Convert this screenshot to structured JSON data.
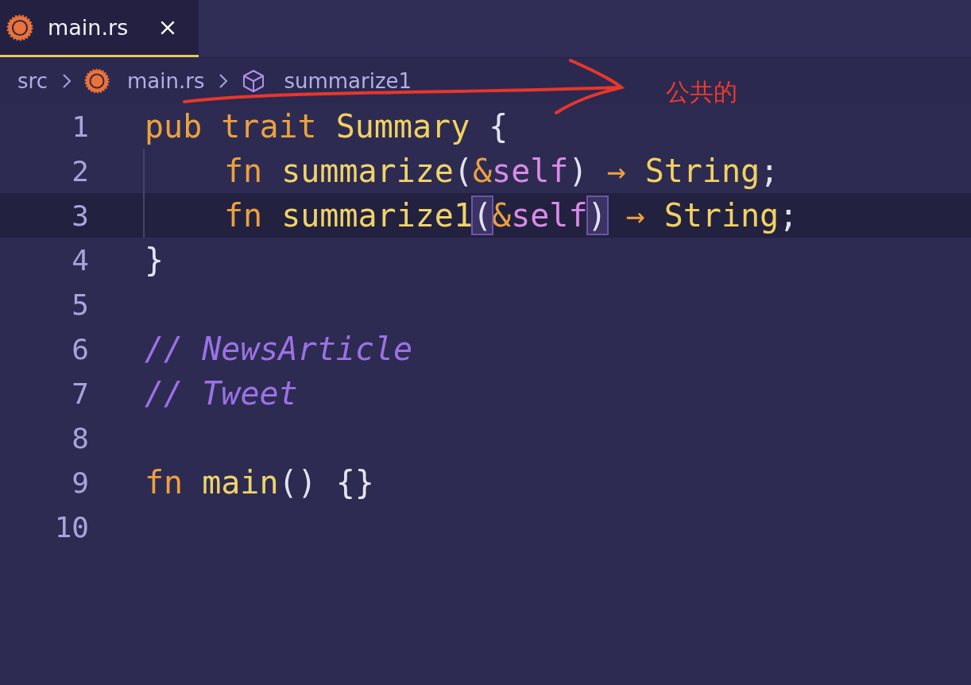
{
  "tabs": [
    {
      "label": "main.rs",
      "selected": true
    }
  ],
  "breadcrumbs": [
    {
      "label": "src"
    },
    {
      "label": "main.rs"
    },
    {
      "label": "summarize1"
    }
  ],
  "annotation": {
    "text": "公共的"
  },
  "lines": [
    {
      "number": "1",
      "current": false,
      "indented": false,
      "words": [
        [
          {
            "kind": "keyword",
            "text": "pub"
          }
        ],
        [
          {
            "kind": "keyword",
            "text": "trait"
          }
        ],
        [
          {
            "kind": "type",
            "text": "Summary"
          }
        ],
        [
          {
            "kind": "plain",
            "text": "{"
          }
        ]
      ]
    },
    {
      "number": "2",
      "current": false,
      "indented": true,
      "words": [
        [
          {
            "kind": "keyword",
            "text": "fn"
          }
        ],
        [
          {
            "kind": "function",
            "text": "summarize"
          },
          {
            "kind": "plain",
            "text": "("
          },
          {
            "kind": "keyword",
            "text": "&"
          },
          {
            "kind": "self",
            "text": "self"
          },
          {
            "kind": "plain",
            "text": ")"
          }
        ],
        [
          {
            "kind": "keyword",
            "text": "→"
          }
        ],
        [
          {
            "kind": "type",
            "text": "String"
          },
          {
            "kind": "plain",
            "text": ";"
          }
        ]
      ]
    },
    {
      "number": "3",
      "current": true,
      "indented": true,
      "words": [
        [
          {
            "kind": "keyword",
            "text": "fn"
          }
        ],
        [
          {
            "kind": "function",
            "text": "summarize1"
          },
          {
            "kind": "plain",
            "text": "(",
            "matched": true
          },
          {
            "kind": "keyword",
            "text": "&"
          },
          {
            "kind": "self",
            "text": "self"
          },
          {
            "kind": "plain",
            "text": ")",
            "matched": true
          }
        ],
        [
          {
            "kind": "keyword",
            "text": "→"
          }
        ],
        [
          {
            "kind": "type",
            "text": "String"
          },
          {
            "kind": "plain",
            "text": ";"
          }
        ]
      ]
    },
    {
      "number": "4",
      "current": false,
      "indented": false,
      "words": [
        [
          {
            "kind": "plain",
            "text": "}"
          }
        ]
      ]
    },
    {
      "number": "5",
      "current": false,
      "indented": false
    },
    {
      "number": "6",
      "current": false,
      "indented": false,
      "words": [
        [
          {
            "kind": "comment",
            "text": "// NewsArticle"
          }
        ]
      ]
    },
    {
      "number": "7",
      "current": false,
      "indented": false,
      "words": [
        [
          {
            "kind": "comment",
            "text": "// Tweet"
          }
        ]
      ]
    },
    {
      "number": "8",
      "current": false,
      "indented": false
    },
    {
      "number": "9",
      "current": false,
      "indented": false,
      "words": [
        [
          {
            "kind": "keyword",
            "text": "fn"
          }
        ],
        [
          {
            "kind": "function",
            "text": "main"
          },
          {
            "kind": "plain",
            "text": "()"
          }
        ],
        [
          {
            "kind": "plain",
            "text": "{}"
          }
        ]
      ]
    },
    {
      "number": "10",
      "current": false,
      "indented": false
    }
  ]
}
